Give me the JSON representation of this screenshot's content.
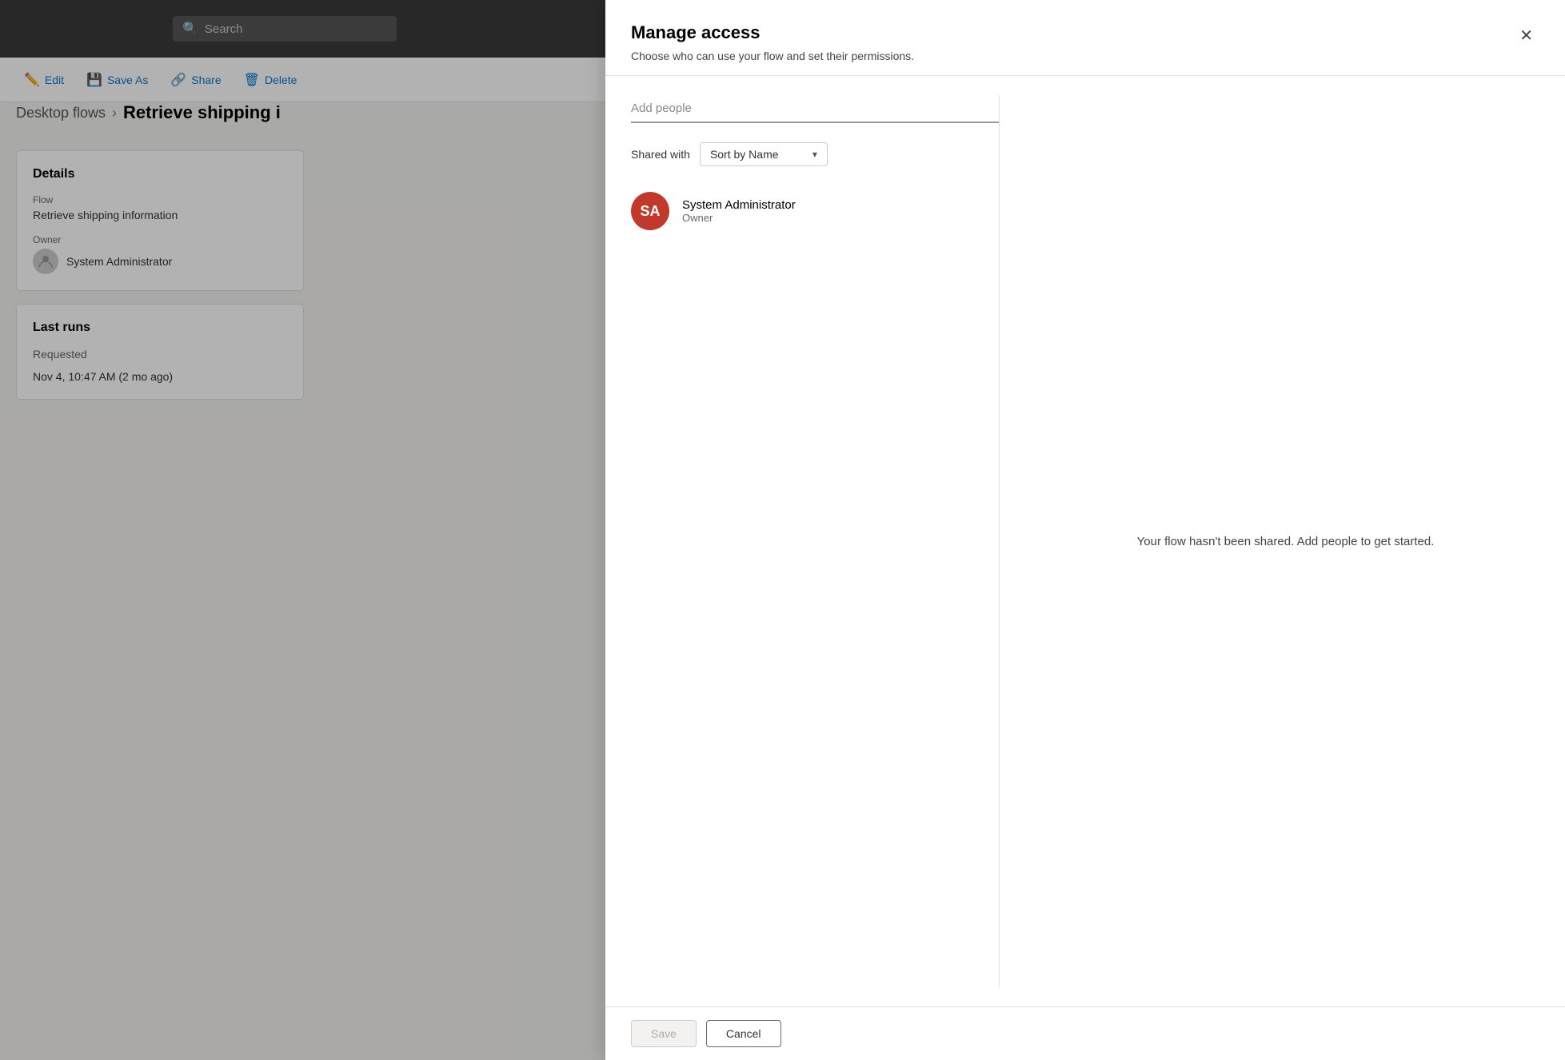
{
  "topnav": {
    "search_placeholder": "Search"
  },
  "toolbar": {
    "edit_label": "Edit",
    "saveas_label": "Save As",
    "share_label": "Share",
    "delete_label": "Delete"
  },
  "breadcrumb": {
    "parent": "Desktop flows",
    "separator": "›",
    "current": "Retrieve shipping i"
  },
  "details_card": {
    "title": "Details",
    "flow_label": "Flow",
    "flow_value": "Retrieve shipping information",
    "owner_label": "Owner",
    "owner_name": "System Administrator"
  },
  "runs_card": {
    "title": "Last runs",
    "requested_label": "Requested",
    "run_date": "Nov 4, 10:47 AM (2 mo ago)"
  },
  "modal": {
    "title": "Manage access",
    "subtitle": "Choose who can use your flow and set their permissions.",
    "close_icon": "✕",
    "add_people_placeholder": "Add people",
    "shared_with_label": "Shared with",
    "sort_by_label": "Sort by Name",
    "user_avatar_initials": "SA",
    "user_name": "System Administrator",
    "user_role": "Owner",
    "empty_message": "Your flow hasn't been shared. Add people to get started.",
    "save_label": "Save",
    "cancel_label": "Cancel"
  }
}
